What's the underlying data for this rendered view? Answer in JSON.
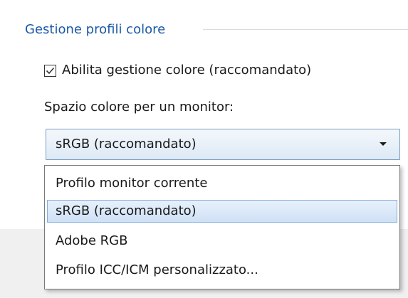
{
  "group": {
    "title": "Gestione profili colore"
  },
  "color_management": {
    "enable_label": "Abilita gestione colore (raccomandato)",
    "enabled": true,
    "colorspace_label": "Spazio colore per un monitor:"
  },
  "colorspace_select": {
    "value": "sRGB (raccomandato)",
    "options": [
      "Profilo monitor corrente",
      "sRGB (raccomandato)",
      "Adobe RGB",
      "Profilo ICC/ICM personalizzato..."
    ],
    "highlighted_option": "sRGB (raccomandato)"
  },
  "icons": {
    "checkbox_check": "checkmark-icon",
    "dropdown_arrow": "chevron-down-icon"
  },
  "colors": {
    "group_title": "#1c58a6",
    "selection_border": "#84acdd",
    "selection_fill": "#cfe1f6"
  }
}
